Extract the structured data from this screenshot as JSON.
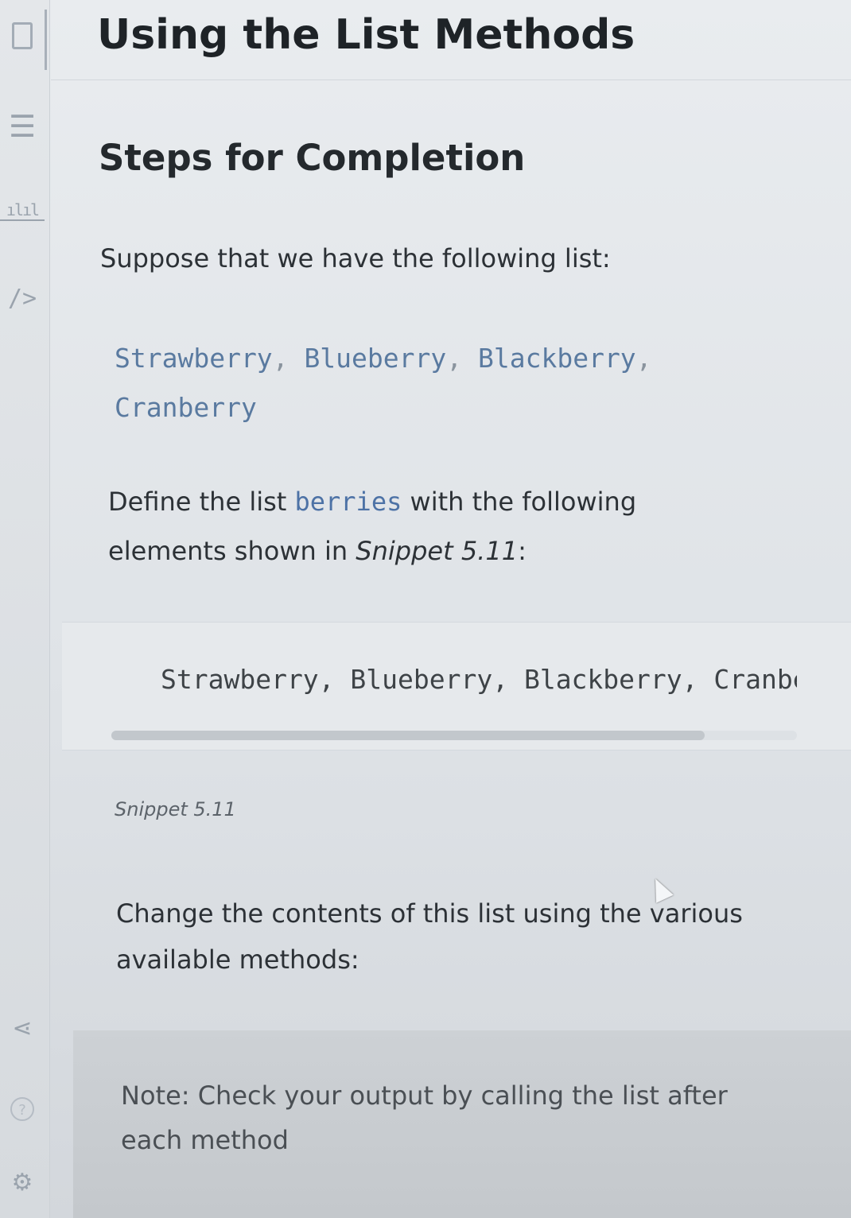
{
  "header": {
    "title": "Using the List Methods"
  },
  "sidebar": {
    "icons": [
      "document-icon",
      "menu-icon",
      "chart-icon",
      "code-icon",
      "share-icon",
      "help-icon",
      "settings-icon"
    ],
    "help_glyph": "?"
  },
  "main": {
    "section_title": "Steps for Completion",
    "intro": "Suppose that we have the following list:",
    "inline_list": {
      "items": [
        "Strawberry",
        "Blueberry",
        "Blackberry",
        "Cranberry"
      ],
      "separator": ","
    },
    "define": {
      "before": "Define the list ",
      "code": "berries",
      "after": " with the following elements shown in ",
      "emphasis": "Snippet 5.11",
      "end": ":"
    },
    "snippet": {
      "code": "Strawberry, Blueberry, Blackberry, Cranberry",
      "caption": "Snippet 5.11"
    },
    "change_text": "Change the contents of this list using the various available methods:",
    "note": "Note: Check your output by calling the list after each method"
  },
  "colors": {
    "code_inline": "#5a7aa0",
    "code_keyword": "#4d72a6",
    "text": "#2c3136",
    "note_bg": "#c8ccd0"
  }
}
